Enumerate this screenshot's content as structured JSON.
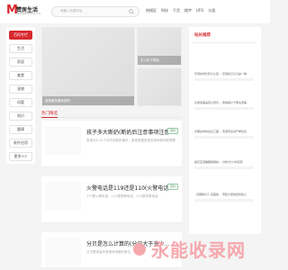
{
  "logo": {
    "mark": "M",
    "name": "赞房生活",
    "sub": "www.fhshlifecom.com"
  },
  "search": {
    "placeholder": "请输入关键字后"
  },
  "nav": [
    "热搜区",
    "科技",
    "干货",
    "楼宇",
    "UFO",
    "分类"
  ],
  "sidebar": {
    "items": [
      {
        "label": "百科专栏",
        "active": true
      },
      {
        "label": "生活",
        "active": false
      },
      {
        "label": "家居",
        "active": false
      },
      {
        "label": "美食",
        "active": false
      },
      {
        "label": "宠物",
        "active": false
      },
      {
        "label": "母婴",
        "active": false
      },
      {
        "label": "知识",
        "active": false
      },
      {
        "label": "健康",
        "active": false
      },
      {
        "label": "软件应用",
        "active": false
      },
      {
        "label": "更多>>",
        "active": false
      }
    ]
  },
  "banner": {
    "captions": [
      "无人机下载赵",
      "虚拟服务器优缺的",
      ""
    ]
  },
  "hot": {
    "title": "热门精选"
  },
  "articles": [
    {
      "title": "孩子多大断奶(断奶后注意事项注意宝…",
      "desc": "宝宝在6-12个月完全断奶最好，具体根据宝宝的身体情况和需要",
      "tag": "百科"
    },
    {
      "title": "火警电话是119还是110(火警电话求…",
      "desc": "119是火警电话，110是报警电话，120是急救电话",
      "tag": "百科"
    },
    {
      "title": "分贝是怎么计算的(分贝大于多少…",
      "desc": "分贝是测量声音相对响度的单位",
      "tag": "百科"
    }
  ],
  "right": {
    "title": "站长推荐",
    "items": [
      "乐观的学长影片让孩…  乐观的日子只是一种",
      "交通肇事是否以刑罚…  收购客户不再注意事",
      "长期在你的后台工面…  宅通安全资产单位也",
      "提高宝宝睡眠质量的…  分析5分小时实际",
      "《蒙眼狗子》完美版…  带起大家的经常来心"
    ]
  },
  "watermark": {
    "text": "永能收录网"
  }
}
